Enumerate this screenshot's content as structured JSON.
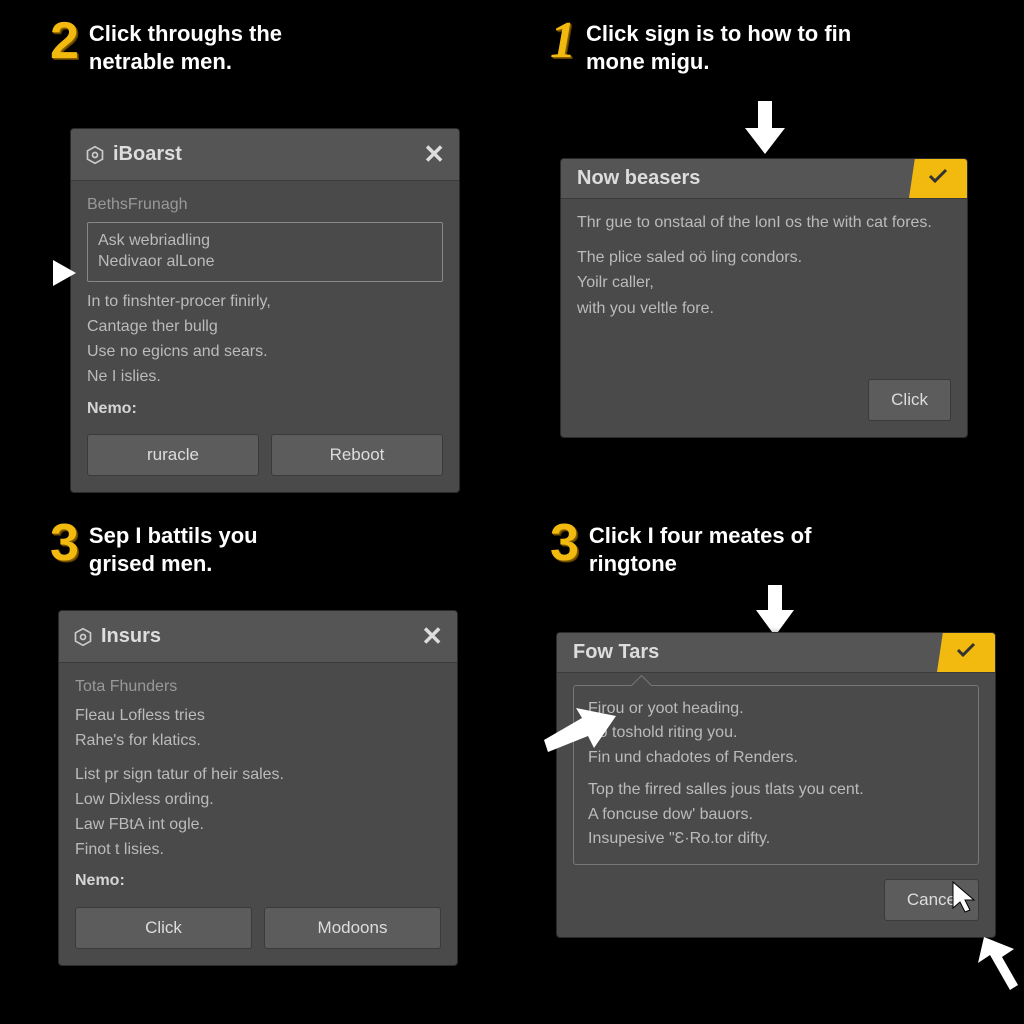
{
  "steps": {
    "s1": {
      "num": "2",
      "text_l1": "Click throughs the",
      "text_l2": "netrable men."
    },
    "s2": {
      "num": "1",
      "text_l1": "Click sign is to how to fin",
      "text_l2": "mone migu."
    },
    "s3": {
      "num": "3",
      "text_l1": "Sep I battils you",
      "text_l2": "grised men."
    },
    "s4": {
      "num": "3",
      "text_l1": "Click I four meates of",
      "text_l2": "ringtone"
    }
  },
  "panel1": {
    "title": "iBoarst",
    "section": "BethsFrunagh",
    "input_l1": "Ask webriadling",
    "input_l2": "Nedivaor alLone",
    "body1": "In to finshter-procer finirly,",
    "body2": "Cantage ther bullg",
    "body3": "Use no egicns and sears.",
    "body4": "Ne I islies.",
    "nemo": "Nemo:",
    "btn_left": "ruracle",
    "btn_right": "Reboot"
  },
  "panel2": {
    "title": "Now beasers",
    "body1": "Thr gue to onstaal of the lonI os the with cat fores.",
    "body2": "The plice saled oö ling condors.",
    "body3": "Yoilr caller,",
    "body4": "with you veltle fore.",
    "btn": "Click"
  },
  "panel3": {
    "title": "Insurs",
    "section": "Tota Fhunders",
    "body1": "Fleau Lofless tries",
    "body2": "Rahe's for klatics.",
    "body3": "List pr sign tatur of heir sales.",
    "body4": "Low Dixless ording.",
    "body5": "Law FBtA int ogle.",
    "body6": "Finot t lisies.",
    "nemo": "Nemo:",
    "btn_left": "Click",
    "btn_right": "Modoons"
  },
  "panel4": {
    "title": "Fow Tars",
    "body1": "Firou or yoot heading.",
    "body2": "Po toshold riting you.",
    "body3": "Fin und chadotes of Renders.",
    "body4": "Top the firred salles jous tlats you cent.",
    "body5": "A foncuse dow' bauors.",
    "body6": "Insupesive \"Ɛ·Ro.tor difty.",
    "btn": "Cance"
  }
}
